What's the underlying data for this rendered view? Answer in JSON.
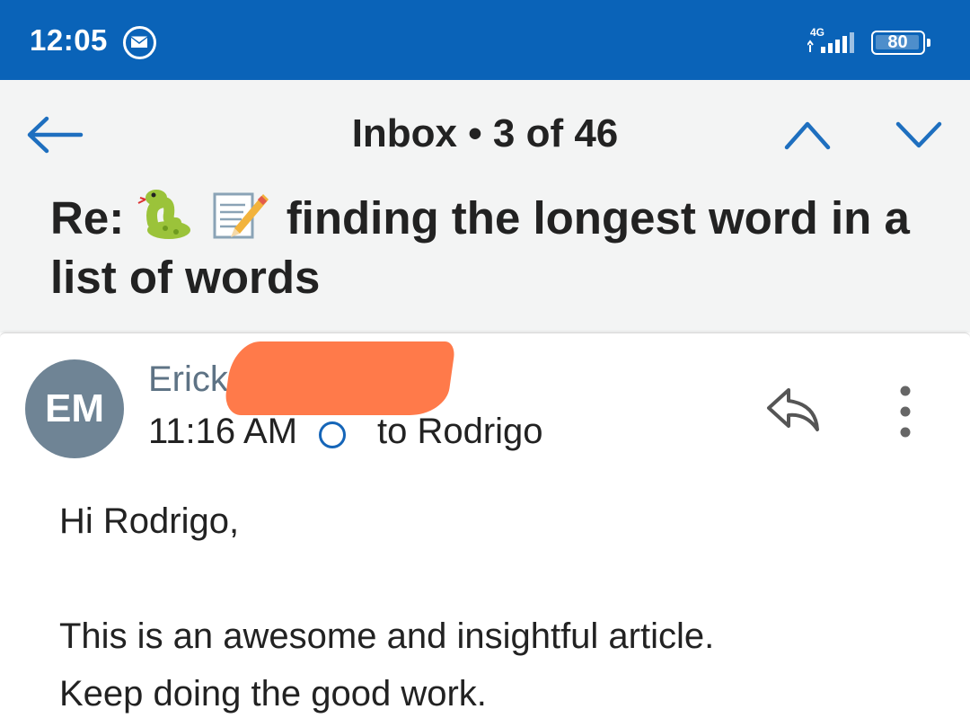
{
  "status_bar": {
    "time": "12:05",
    "network": "4G",
    "battery": "80",
    "icons": [
      "mail-notification-icon",
      "signal-icon",
      "battery-icon"
    ]
  },
  "header": {
    "title": "Inbox • 3 of 46",
    "subject_prefix": "Re:",
    "subject_text": "finding the longest word in a list of words",
    "subject_emojis": [
      "snake",
      "memo"
    ],
    "icons": [
      "back-arrow-icon",
      "chevron-up-icon",
      "chevron-down-icon"
    ]
  },
  "message": {
    "avatar_initials": "EM",
    "sender": "Erick",
    "time": "11:16 AM",
    "recipient": "to Rodrigo",
    "body": [
      "Hi Rodrigo,",
      "",
      "This is an awesome and insightful article.",
      "Keep doing the good work."
    ],
    "icons": [
      "reply-icon",
      "more-vertical-icon",
      "unread-circle-icon"
    ]
  },
  "colors": {
    "status_bar": "#0a63b8",
    "accent": "#1565b8",
    "header_bg": "#f3f4f4",
    "avatar_bg": "#6f8495",
    "redaction": "#ff7a4a"
  }
}
